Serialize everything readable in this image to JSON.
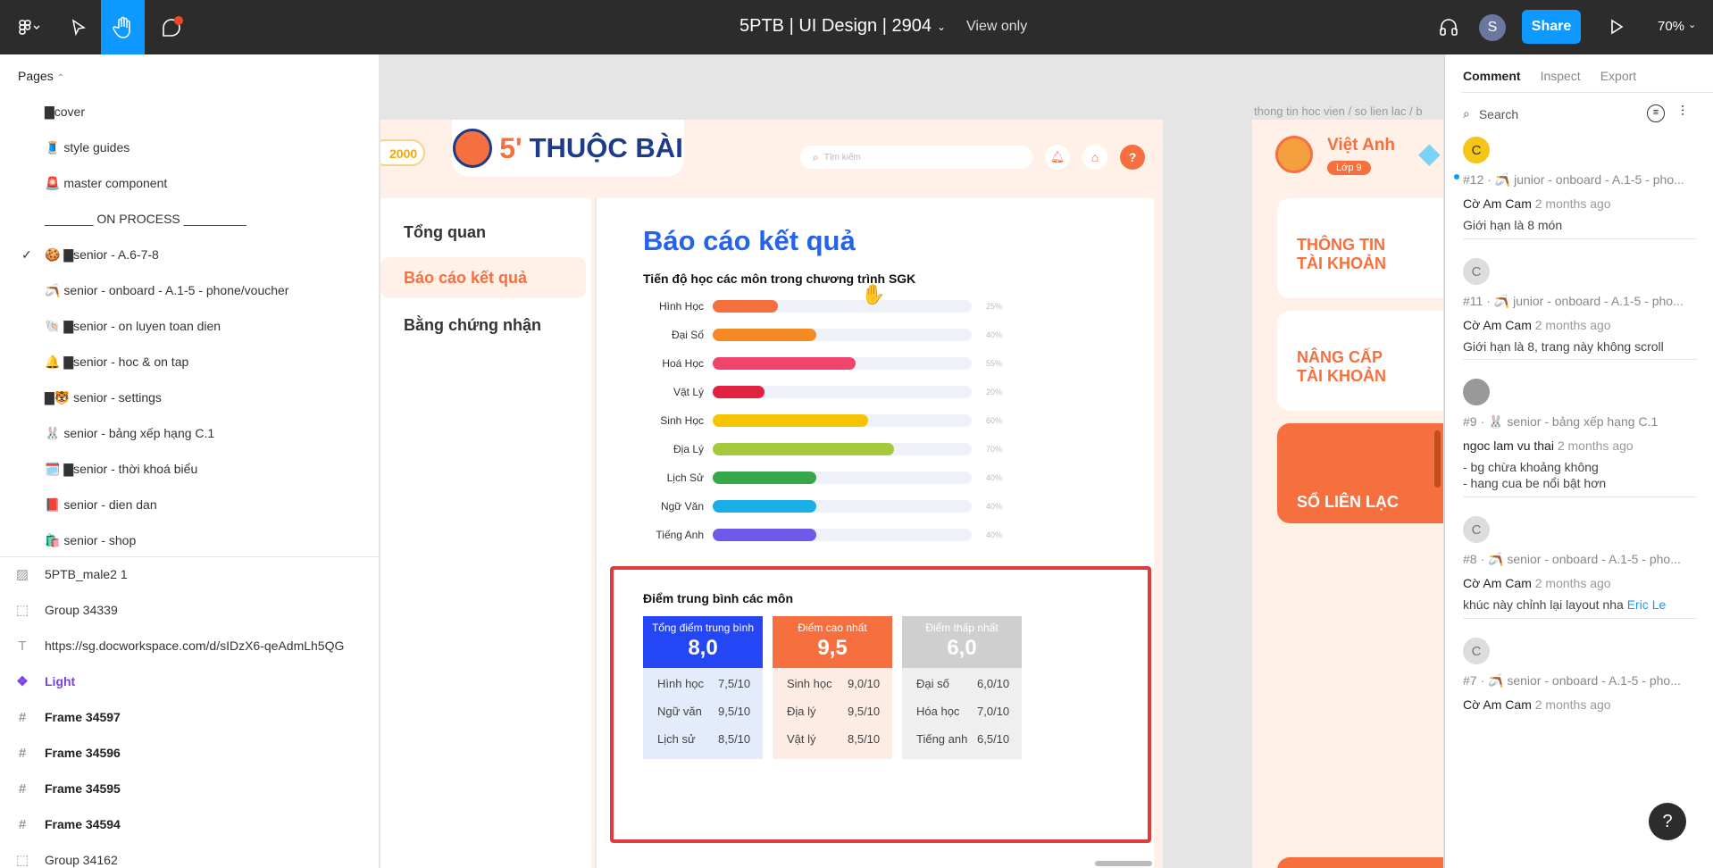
{
  "toolbar": {
    "title": "5PTB | UI Design | 2904",
    "view": "View only",
    "avatar": "S",
    "share": "Share",
    "zoom": "70%"
  },
  "pages": {
    "header": "Pages",
    "items": [
      "▇cover",
      "🧵 style guides",
      "🚨 master component",
      "_______ ON PROCESS _________",
      "🍪 ▇senior - A.6-7-8",
      "🪃 senior - onboard - A.1-5 - phone/voucher",
      "🐚 ▇senior - on luyen toan dien",
      "🔔 ▇senior - hoc & on tap",
      "▇🐯 senior - settings",
      "🐰 senior - bảng xếp hạng C.1",
      "🗓️ ▇senior - thời khoá biểu",
      "📕 senior - dien dan",
      "🛍️ senior - shop"
    ]
  },
  "layers": [
    "5PTB_male2 1",
    "Group 34339",
    "https://sg.docworkspace.com/d/sIDzX6-qeAdmLh5QG",
    "Light",
    "Frame 34597",
    "Frame 34596",
    "Frame 34595",
    "Frame 34594",
    "Group 34162"
  ],
  "app": {
    "coins": "2000",
    "logo_num": "5'",
    "logo": "THUỘC BÀI",
    "search_ph": "Tìm kiếm",
    "help": "?",
    "menu": [
      "Tổng quan",
      "Báo cáo kết quả",
      "Bằng chứng nhận"
    ],
    "report_title": "Báo cáo kết quả",
    "progress_title": "Tiến độ học các môn trong chương trình SGK",
    "breadcrumb": "thong tin hoc vien / so lien lac / b",
    "user": "Việt Anh",
    "grade": "Lớp 9",
    "r_cards": [
      "THÔNG TIN TÀI KHOẢN",
      "NÂNG CẤP TÀI KHOẢN",
      "SỔ LIÊN LẠC"
    ]
  },
  "chart_data": {
    "type": "bar",
    "categories": [
      "Hình Học",
      "Đại Số",
      "Hoá Học",
      "Vật Lý",
      "Sinh Học",
      "Địa Lý",
      "Lịch Sử",
      "Ngữ Văn",
      "Tiếng Anh"
    ],
    "values": [
      25,
      40,
      55,
      20,
      60,
      70,
      40,
      40,
      40
    ],
    "labels": [
      "25%",
      "40%",
      "55%",
      "20%",
      "60%",
      "70%",
      "40%",
      "40%",
      "40%"
    ],
    "colors": [
      "#f5703e",
      "#f58a24",
      "#f0446e",
      "#e0213f",
      "#f6c400",
      "#a5c93a",
      "#36a84a",
      "#1aaee6",
      "#6b5be8"
    ],
    "ylim": [
      0,
      100
    ]
  },
  "scores": {
    "title": "Điểm trung bình các môn",
    "cards": [
      {
        "head": "Tổng điểm trung bình",
        "value": "8,0",
        "rows": [
          [
            "Hình học",
            "7,5/10"
          ],
          [
            "Ngữ văn",
            "9,5/10"
          ],
          [
            "Lịch sử",
            "8,5/10"
          ]
        ]
      },
      {
        "head": "Điểm cao nhất",
        "value": "9,5",
        "rows": [
          [
            "Sinh học",
            "9,0/10"
          ],
          [
            "Địa lý",
            "9,5/10"
          ],
          [
            "Vật lý",
            "8,5/10"
          ]
        ]
      },
      {
        "head": "Điểm thấp nhất",
        "value": "6,0",
        "rows": [
          [
            "Đại số",
            "6,0/10"
          ],
          [
            "Hóa học",
            "7,0/10"
          ],
          [
            "Tiếng anh",
            "6,5/10"
          ]
        ]
      }
    ]
  },
  "comments": {
    "tabs": [
      "Comment",
      "Inspect",
      "Export"
    ],
    "search_ph": "Search",
    "items": [
      {
        "av": "C",
        "id": "#12 · 🪃 junior - onboard - A.1-5 - pho...",
        "user": "Cờ Am Cam",
        "time": "2 months ago",
        "text": [
          "Giới hạn là 8 món"
        ]
      },
      {
        "av": "C",
        "id": "#11 · 🪃 junior - onboard - A.1-5 - pho...",
        "user": "Cờ Am Cam",
        "time": "2 months ago",
        "text": [
          "Giới hạn là 8, trang này không scroll"
        ]
      },
      {
        "av": "",
        "id": "#9 · 🐰 senior - bảng xếp hạng C.1",
        "user": "ngoc lam vu thai",
        "time": "2 months ago",
        "text": [
          "- bg chừa khoảng không",
          "- hang cua be nổi bật hơn"
        ]
      },
      {
        "av": "C",
        "id": "#8 · 🪃 senior - onboard - A.1-5 - pho...",
        "user": "Cờ Am Cam",
        "time": "2 months ago",
        "text": [
          "khúc này chỉnh lại layout nha"
        ],
        "mention": "Eric Le"
      },
      {
        "av": "C",
        "id": "#7 · 🪃 senior - onboard - A.1-5 - pho...",
        "user": "Cờ Am Cam",
        "time": "2 months ago",
        "text": []
      }
    ],
    "help": "?"
  }
}
